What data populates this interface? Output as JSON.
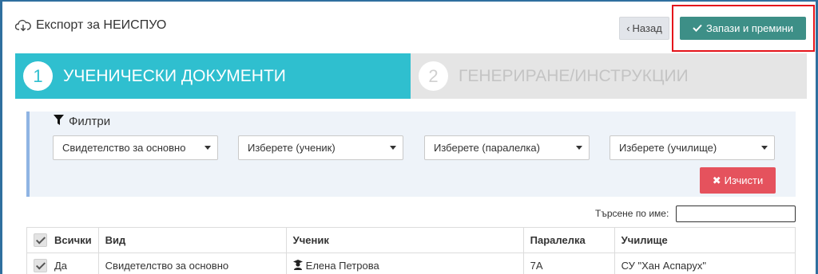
{
  "header": {
    "title": "Експорт за НЕИСПУО",
    "back_label": "Назад",
    "save_label": "Запази и премини"
  },
  "steps": [
    {
      "number": "1",
      "label": "УЧЕНИЧЕСКИ ДОКУМЕНТИ",
      "active": true
    },
    {
      "number": "2",
      "label": "ГЕНЕРИРАНЕ/ИНСТРУКЦИИ",
      "active": false
    }
  ],
  "filters": {
    "title": "Филтри",
    "document_type": "Свидетелство за основно",
    "student": "Изберете (ученик)",
    "class": "Изберете (паралелка)",
    "school": "Изберете (училище)",
    "clear_label": "Изчисти"
  },
  "search": {
    "label": "Търсене по име:",
    "value": ""
  },
  "table": {
    "columns": {
      "select_all": "Всички",
      "type": "Вид",
      "student": "Ученик",
      "class": "Паралелка",
      "school": "Училище"
    },
    "rows": [
      {
        "selected": "Да",
        "type": "Свидетелство за основно",
        "student": "Елена Петрова",
        "class": "7А",
        "school": "СУ \"Хан Аспарух\""
      }
    ]
  },
  "colors": {
    "step_active": "#2fbfcf",
    "save_button": "#3d8f87",
    "clear_button": "#e5525d",
    "highlight": "#e4141b"
  }
}
